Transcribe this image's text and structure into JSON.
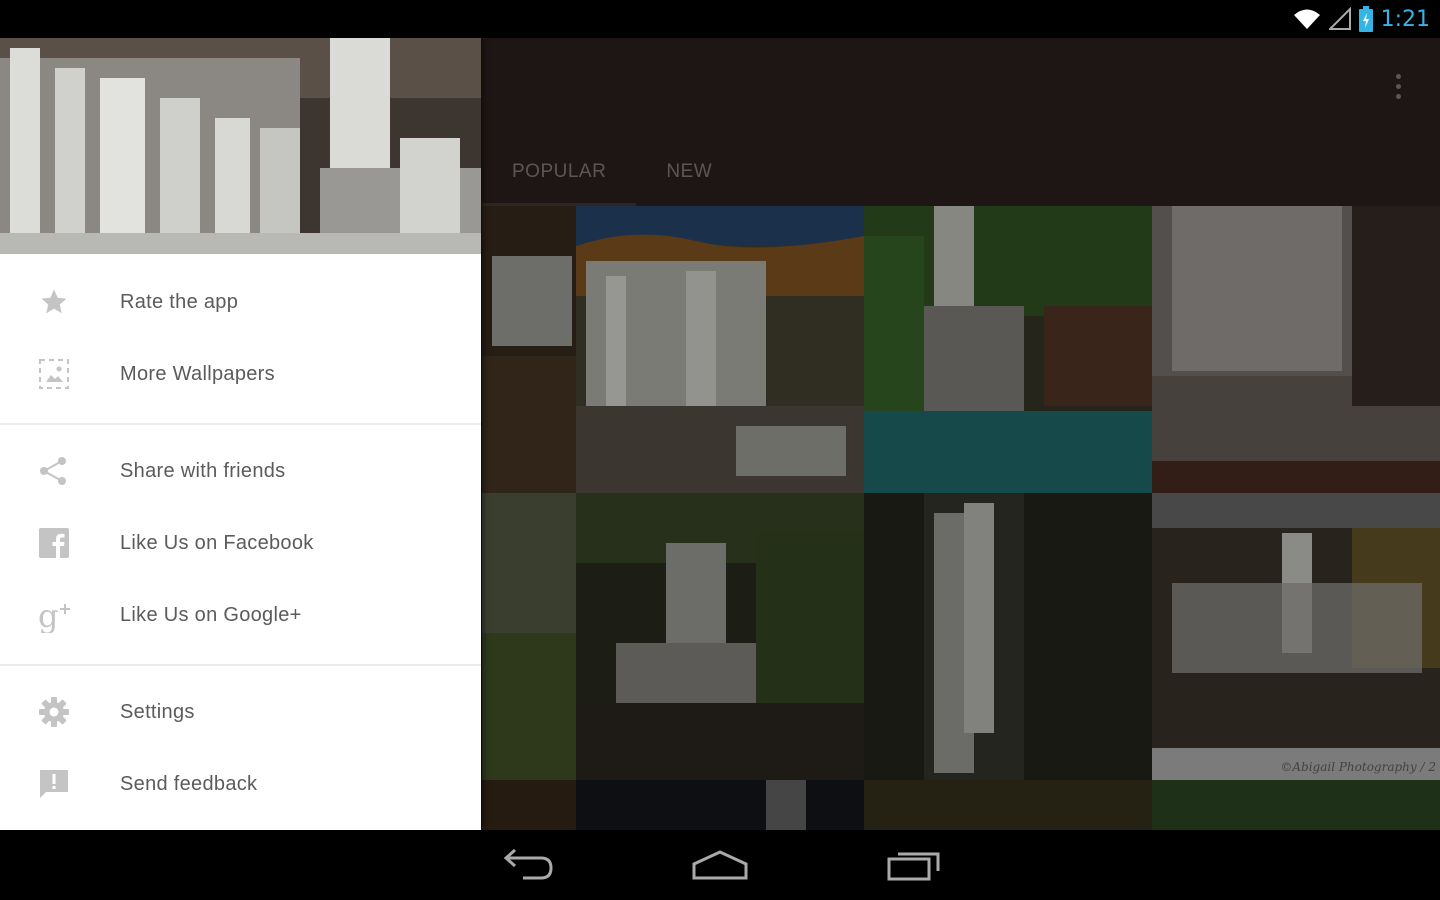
{
  "status_bar": {
    "time": "1:21",
    "icons": [
      "wifi-icon",
      "signal-icon",
      "battery-icon"
    ]
  },
  "toolbar": {
    "overflow_icon": "more-vertical-icon"
  },
  "tabs": [
    {
      "label": "POPULAR",
      "active": true
    },
    {
      "label": "NEW",
      "active": false
    }
  ],
  "drawer": {
    "menu": [
      {
        "label": "Rate the app",
        "icon": "star-icon"
      },
      {
        "label": "More Wallpapers",
        "icon": "wallpaper-icon"
      },
      {
        "label": "Share with friends",
        "icon": "share-icon"
      },
      {
        "label": "Like Us on Facebook",
        "icon": "facebook-icon"
      },
      {
        "label": "Like Us on Google+",
        "icon": "google-plus-icon"
      },
      {
        "label": "Settings",
        "icon": "gear-icon"
      },
      {
        "label": "Send feedback",
        "icon": "feedback-icon"
      }
    ]
  },
  "grid": {
    "watermark": "©Abigail Photography / 2"
  },
  "nav_bar": {
    "buttons": [
      "back-icon",
      "home-icon",
      "recents-icon"
    ]
  },
  "colors": {
    "toolbar": "#2f2220",
    "accent": "#33b5e5",
    "drawer_text": "#5b5b5b",
    "icon_gray": "#c4c4c4"
  }
}
